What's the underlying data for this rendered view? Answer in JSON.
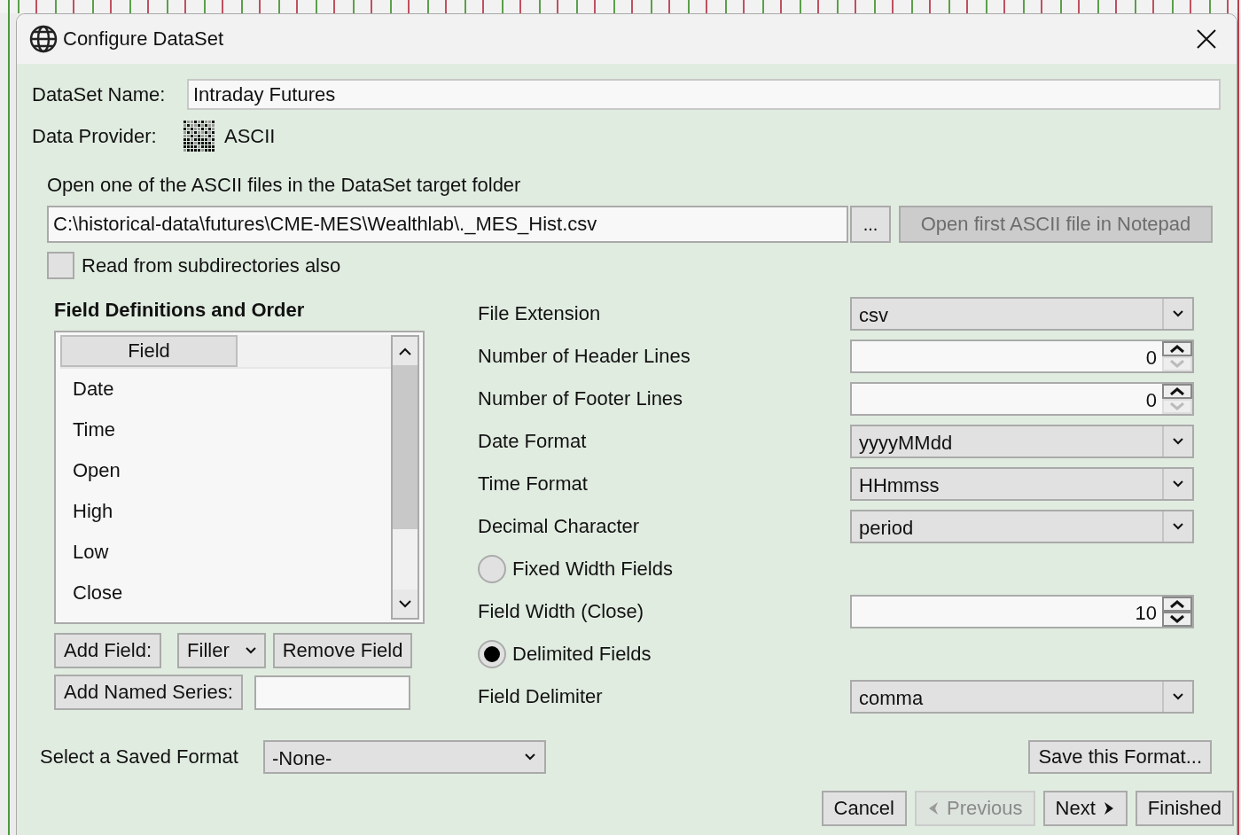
{
  "window": {
    "title": "Configure DataSet"
  },
  "dataset_name": {
    "label": "DataSet Name:",
    "value": "Intraday Futures"
  },
  "data_provider": {
    "label": "Data Provider:",
    "value": "ASCII"
  },
  "files": {
    "label": "Open one of the ASCII files in the DataSet target folder",
    "path": "C:\\historical-data\\futures\\CME-MES\\Wealthlab\\._MES_Hist.csv",
    "browse": "...",
    "notepad_button": {
      "label": "Open first ASCII file in Notepad",
      "disabled": true
    },
    "subdirectories": {
      "label": "Read from subdirectories also",
      "checked": false
    }
  },
  "fields": {
    "title": "Field Definitions and Order",
    "column": "Field",
    "rows": [
      "Date",
      "Time",
      "Open",
      "High",
      "Low",
      "Close"
    ],
    "add_field": "Add Field:",
    "field_type": "Filler",
    "remove_field": "Remove Field",
    "add_series": "Add Named Series:"
  },
  "settings": [
    {
      "kind": "select",
      "label": "File Extension",
      "value": "csv"
    },
    {
      "kind": "spinner",
      "label": "Number of Header Lines",
      "value": "0",
      "down_disabled": true
    },
    {
      "kind": "spinner",
      "label": "Number of Footer Lines",
      "value": "0",
      "down_disabled": true
    },
    {
      "kind": "select",
      "label": "Date Format",
      "value": "yyyyMMdd"
    },
    {
      "kind": "select",
      "label": "Time Format",
      "value": "HHmmss"
    },
    {
      "kind": "select",
      "label": "Decimal Character",
      "value": "period"
    },
    {
      "kind": "radio",
      "label": "Fixed Width Fields",
      "selected": false
    },
    {
      "kind": "spinner",
      "label": "Field Width (Close)",
      "value": "10",
      "down_disabled": false
    },
    {
      "kind": "radio",
      "label": "Delimited Fields",
      "selected": true
    },
    {
      "kind": "select",
      "label": "Field Delimiter",
      "value": "comma"
    }
  ],
  "saved_format": {
    "label": "Select a Saved Format",
    "value": "-None-",
    "save_button": "Save this Format..."
  },
  "buttons": [
    {
      "kind": "plain",
      "label": "Cancel",
      "disabled": false
    },
    {
      "kind": "back",
      "label": "Previous",
      "disabled": true
    },
    {
      "kind": "forward",
      "label": "Next",
      "disabled": false
    },
    {
      "kind": "plain",
      "label": "Finished",
      "disabled": false
    }
  ]
}
